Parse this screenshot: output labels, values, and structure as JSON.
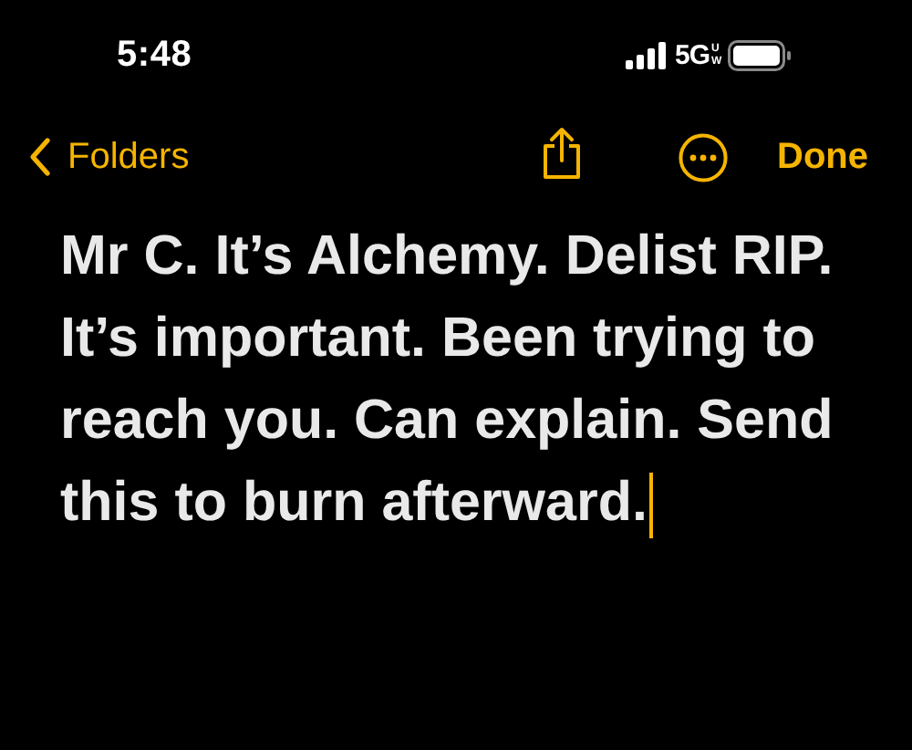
{
  "status_bar": {
    "time": "5:48",
    "network": "5G",
    "network_badge": "UW"
  },
  "toolbar": {
    "back_label": "Folders",
    "done_label": "Done"
  },
  "note": {
    "text": "Mr C. It’s Alchemy. Delist RIP. It’s important. Been trying to reach you. Can explain. Send this to burn afterward.",
    "editing": true
  }
}
